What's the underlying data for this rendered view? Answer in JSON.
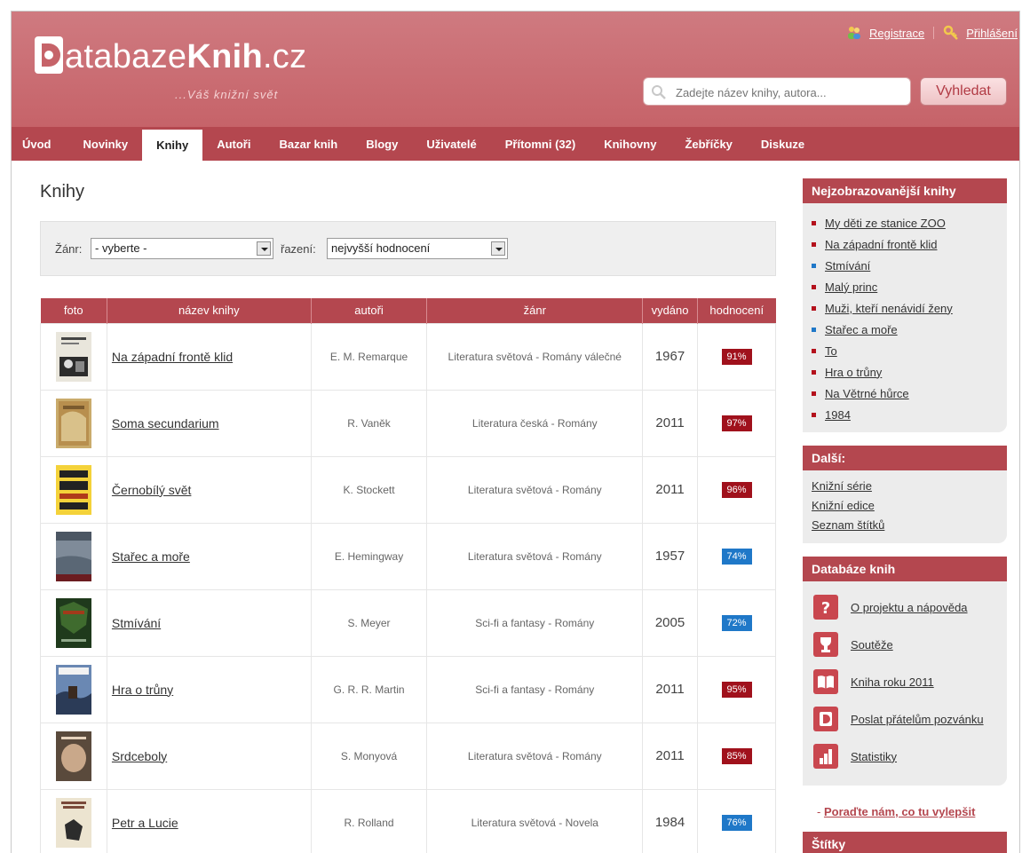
{
  "header": {
    "logo_d": "D",
    "logo_part1": "atabaze",
    "logo_part2": "Knih",
    "logo_part3": ".cz",
    "tagline": "...Váš knižní svět",
    "register": "Registrace",
    "login": "Přihlášení",
    "search_placeholder": "Zadejte název knihy, autora...",
    "search_button": "Vyhledat"
  },
  "nav": [
    {
      "label": "Úvod"
    },
    {
      "label": "Novinky"
    },
    {
      "label": "Knihy"
    },
    {
      "label": "Autoři"
    },
    {
      "label": "Bazar knih"
    },
    {
      "label": "Blogy"
    },
    {
      "label": "Uživatelé"
    },
    {
      "label": "Přítomni (32)"
    },
    {
      "label": "Knihovny"
    },
    {
      "label": "Žebříčky"
    },
    {
      "label": "Diskuze"
    }
  ],
  "main": {
    "title": "Knihy",
    "filter": {
      "genre_label": "Žánr:",
      "genre_value": "- vyberte -",
      "sort_label": "řazení:",
      "sort_value": "nejvyšší hodnocení"
    },
    "columns": [
      "foto",
      "název knihy",
      "autoři",
      "žánr",
      "vydáno",
      "hodnocení"
    ],
    "books": [
      {
        "title": "Na západní frontě klid",
        "author": "E. M. Remarque",
        "genre": "Literatura světová - Romány válečné",
        "year": "1967",
        "rating": "91%",
        "rating_color": "#a0111c"
      },
      {
        "title": "Soma secundarium",
        "author": "R. Vaněk",
        "genre": "Literatura česká - Romány",
        "year": "2011",
        "rating": "97%",
        "rating_color": "#a0111c"
      },
      {
        "title": "Černobílý svět",
        "author": "K. Stockett",
        "genre": "Literatura světová - Romány",
        "year": "2011",
        "rating": "96%",
        "rating_color": "#a0111c"
      },
      {
        "title": "Stařec a moře",
        "author": "E. Hemingway",
        "genre": "Literatura světová - Romány",
        "year": "1957",
        "rating": "74%",
        "rating_color": "#1f78c8"
      },
      {
        "title": "Stmívání",
        "author": "S. Meyer",
        "genre": "Sci-fi a fantasy - Romány",
        "year": "2005",
        "rating": "72%",
        "rating_color": "#1f78c8"
      },
      {
        "title": "Hra o trůny",
        "author": "G. R. R. Martin",
        "genre": "Sci-fi a fantasy - Romány",
        "year": "2011",
        "rating": "95%",
        "rating_color": "#a0111c"
      },
      {
        "title": "Srdceboly",
        "author": "S. Monyová",
        "genre": "Literatura světová - Romány",
        "year": "2011",
        "rating": "85%",
        "rating_color": "#a0111c"
      },
      {
        "title": "Petr a Lucie",
        "author": "R. Rolland",
        "genre": "Literatura světová - Novela",
        "year": "1984",
        "rating": "76%",
        "rating_color": "#1f78c8"
      }
    ]
  },
  "sidebar": {
    "popular_title": "Nejzobrazovanější knihy",
    "popular": [
      {
        "title": "My děti ze stanice ZOO",
        "color": "#b4111c"
      },
      {
        "title": "Na západní frontě klid",
        "color": "#b4111c"
      },
      {
        "title": "Stmívání",
        "color": "#1f78c8"
      },
      {
        "title": "Malý princ",
        "color": "#b4111c"
      },
      {
        "title": "Muži, kteří nenávidí ženy",
        "color": "#b4111c"
      },
      {
        "title": "Stařec a moře",
        "color": "#1f78c8"
      },
      {
        "title": "To",
        "color": "#b4111c"
      },
      {
        "title": "Hra o trůny",
        "color": "#b4111c"
      },
      {
        "title": "Na Větrné hůrce",
        "color": "#b4111c"
      },
      {
        "title": "1984",
        "color": "#b4111c"
      }
    ],
    "more_title": "Další:",
    "more": [
      "Knižní série",
      "Knižní edice",
      "Seznam štítků"
    ],
    "db_title": "Databáze knih",
    "db_items": [
      {
        "label": "O projektu a nápověda",
        "icon": "question-icon"
      },
      {
        "label": "Soutěže",
        "icon": "trophy-icon"
      },
      {
        "label": "Kniha roku 2011",
        "icon": "book-icon"
      },
      {
        "label": "Poslat přátelům pozvánku",
        "icon": "invite-icon"
      },
      {
        "label": "Statistiky",
        "icon": "stats-icon"
      }
    ],
    "improve_prefix": "- ",
    "improve_link": "Poraďte nám, co tu vylepšit",
    "tags_title": "Štítky"
  }
}
